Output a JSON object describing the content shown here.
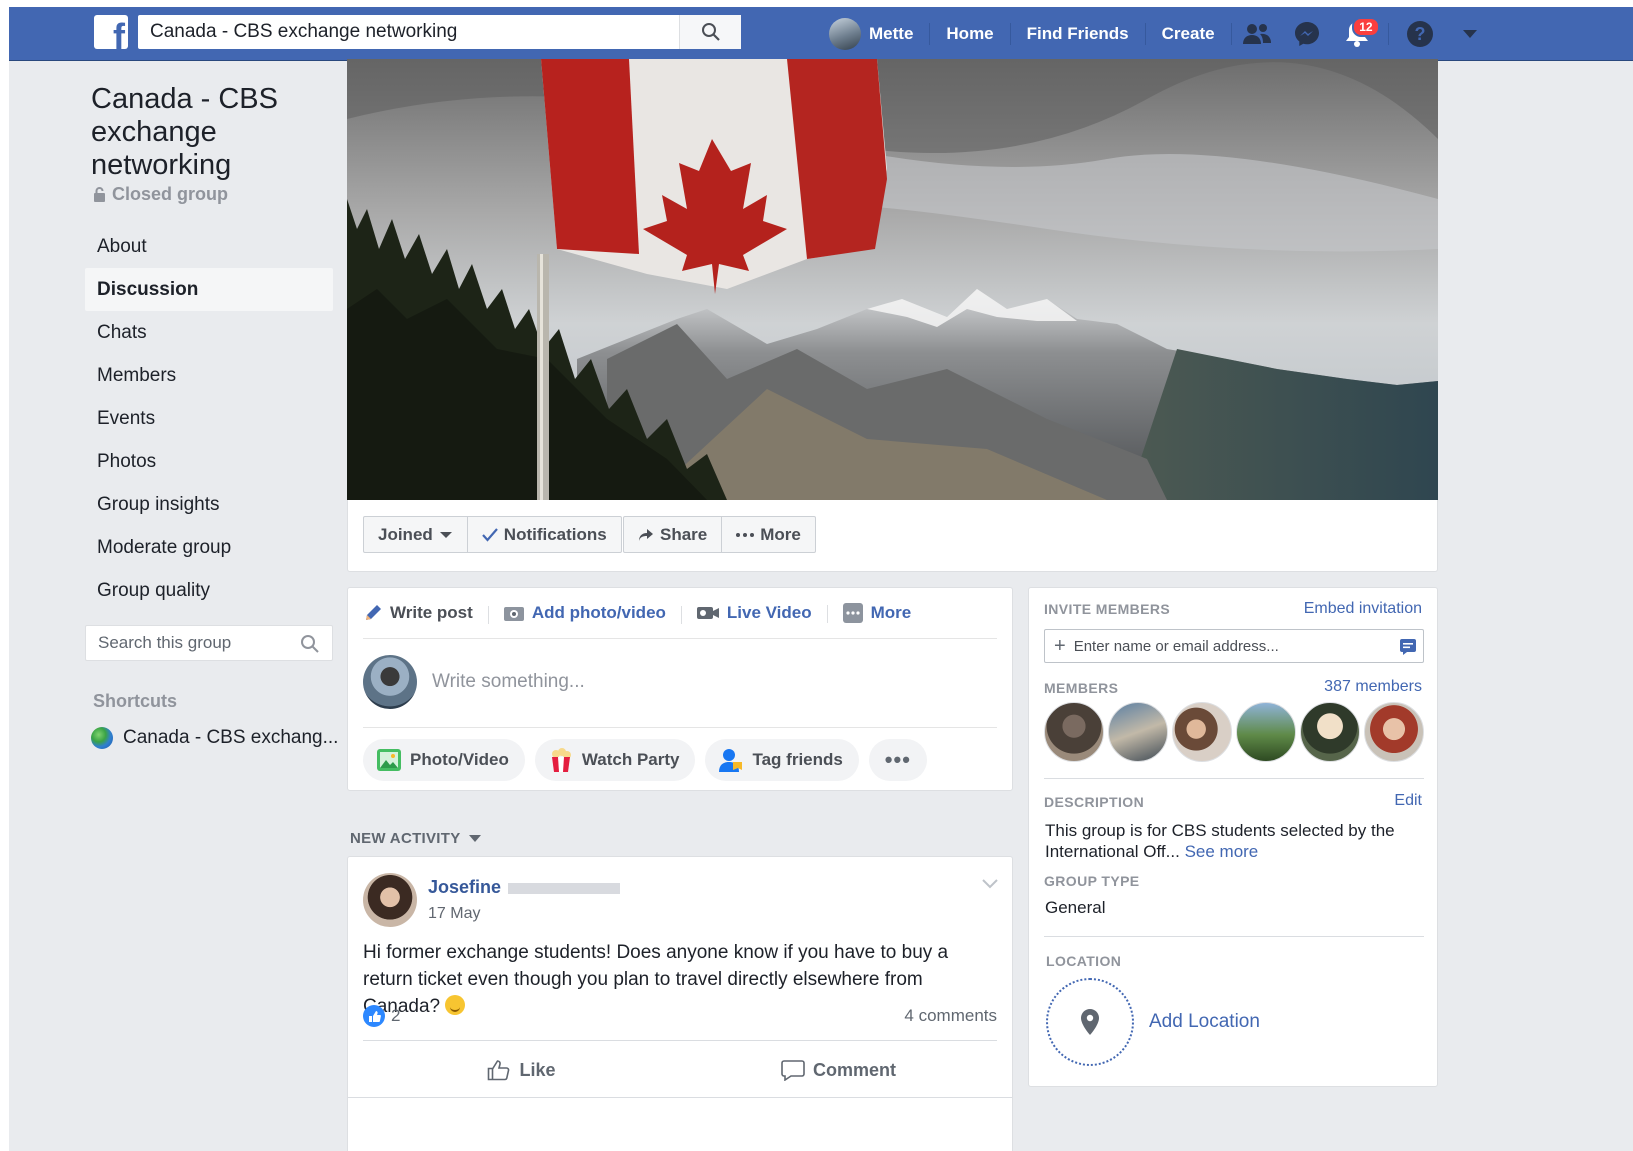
{
  "topbar": {
    "logo_letter": "f",
    "search_value": "Canada - CBS exchange networking",
    "user_name": "Mette",
    "nav_links": [
      "Home",
      "Find Friends",
      "Create"
    ],
    "notification_count": "12",
    "icons": [
      "friends-icon",
      "messenger-icon",
      "notifications-icon",
      "help-icon",
      "dropdown-arrow-icon"
    ]
  },
  "group": {
    "title": "Canada - CBS exchange networking",
    "privacy": "Closed group"
  },
  "leftnav": {
    "items": [
      "About",
      "Discussion",
      "Chats",
      "Members",
      "Events",
      "Photos",
      "Group insights",
      "Moderate group",
      "Group quality"
    ],
    "active": "Discussion",
    "search_placeholder": "Search this group",
    "shortcuts_heading": "Shortcuts",
    "shortcut_item": "Canada - CBS exchang..."
  },
  "cover_actions": {
    "joined": "Joined",
    "notifications": "Notifications",
    "share": "Share",
    "more": "More"
  },
  "composer": {
    "tabs": [
      "Write post",
      "Add photo/video",
      "Live Video",
      "More"
    ],
    "placeholder": "Write something...",
    "pills": [
      "Photo/Video",
      "Watch Party",
      "Tag friends"
    ],
    "dots": "•••"
  },
  "feed": {
    "section_heading": "NEW ACTIVITY"
  },
  "post": {
    "author": "Josefine",
    "date": "17 May",
    "text": "Hi former exchange students! Does anyone know if you have to buy a return ticket even though you plan to travel directly elsewhere from Canada?",
    "reactions": "2",
    "comments": "4 comments",
    "like_label": "Like",
    "comment_label": "Comment"
  },
  "sidebar_right": {
    "invite_heading": "INVITE MEMBERS",
    "embed_link": "Embed invitation",
    "invite_placeholder": "Enter name or email address...",
    "members_heading": "MEMBERS",
    "members_count": "387 members",
    "description_heading": "DESCRIPTION",
    "edit_link": "Edit",
    "description_text": "This group is for CBS students selected by the International Off...",
    "see_more": "See more",
    "group_type_heading": "GROUP TYPE",
    "group_type": "General",
    "location_heading": "LOCATION",
    "add_location": "Add Location"
  },
  "colors": {
    "brand_blue": "#4267b2",
    "link_blue": "#365899",
    "page_bg": "#e9ebee",
    "badge_red": "#fa3e3e"
  }
}
